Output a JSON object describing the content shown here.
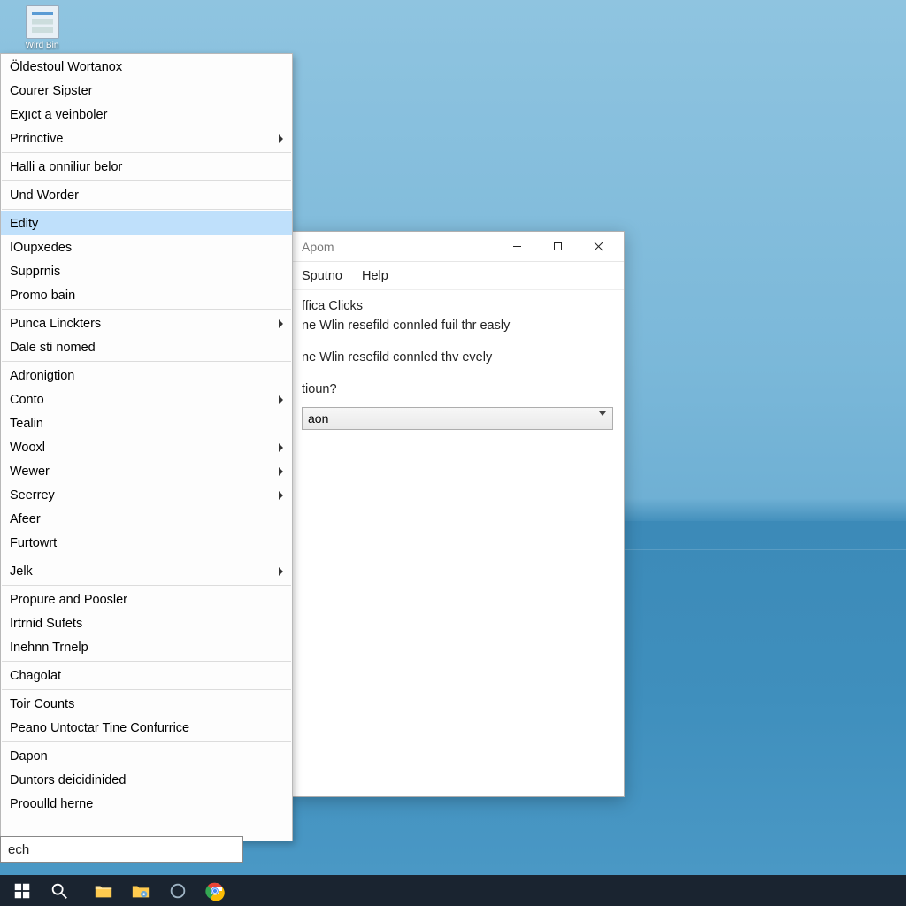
{
  "desktop_icon": {
    "label": "Wird Bin"
  },
  "window": {
    "title": "Apom",
    "menubar": {
      "sputno": "Sputno",
      "help": "Help"
    },
    "content": {
      "line1": "ffica Clicks",
      "line2": "ne Wlin resefild connled fuil thr easly",
      "line3": "ne Wlin resefild connled thv evely",
      "question": "tioun?",
      "dropdown_value": "aon"
    }
  },
  "context_menu": {
    "groups": [
      [
        {
          "label": "Öldestoul Wortanox",
          "submenu": false
        },
        {
          "label": "Courer Sipster",
          "submenu": false
        },
        {
          "label": "Exȷıct a veinboler",
          "submenu": false
        },
        {
          "label": "Prrinctive",
          "submenu": true
        }
      ],
      [
        {
          "label": "Halli a onniliur belor",
          "submenu": false
        }
      ],
      [
        {
          "label": "Und Worder",
          "submenu": false
        }
      ],
      [
        {
          "label": "Edity",
          "submenu": false,
          "highlighted": true
        },
        {
          "label": "IOupxedes",
          "submenu": false
        },
        {
          "label": "Supprnis",
          "submenu": false
        },
        {
          "label": "Promo bain",
          "submenu": false
        }
      ],
      [
        {
          "label": "Punca Linckters",
          "submenu": true
        },
        {
          "label": "Dale sti nomed",
          "submenu": false
        }
      ],
      [
        {
          "label": "Adronigtion",
          "submenu": false
        },
        {
          "label": "Conto",
          "submenu": true
        },
        {
          "label": "Tealin",
          "submenu": false
        },
        {
          "label": "Wooxl",
          "submenu": true
        },
        {
          "label": "Wewer",
          "submenu": true
        },
        {
          "label": "Seerrey",
          "submenu": true
        },
        {
          "label": "Afeer",
          "submenu": false
        },
        {
          "label": "Furtowrt",
          "submenu": false
        }
      ],
      [
        {
          "label": "Jelk",
          "submenu": true
        }
      ],
      [
        {
          "label": "Propure and Poosler",
          "submenu": false
        },
        {
          "label": "Irtrnid Sufets",
          "submenu": false
        },
        {
          "label": "Inehnn Trnelp",
          "submenu": false
        }
      ],
      [
        {
          "label": "Chagolat",
          "submenu": false
        }
      ],
      [
        {
          "label": "Toir Counts",
          "submenu": false
        },
        {
          "label": "Peano Untoctar Tine Confurrice",
          "submenu": false
        }
      ],
      [
        {
          "label": "Dapon",
          "submenu": false
        },
        {
          "label": "Duntors deicidinided",
          "submenu": false
        },
        {
          "label": "Prooulld herne",
          "submenu": false
        }
      ]
    ]
  },
  "search": {
    "value": "ech"
  },
  "taskbar": {
    "items": [
      "start",
      "search",
      "folder",
      "folder-gear",
      "circle",
      "chrome"
    ]
  }
}
